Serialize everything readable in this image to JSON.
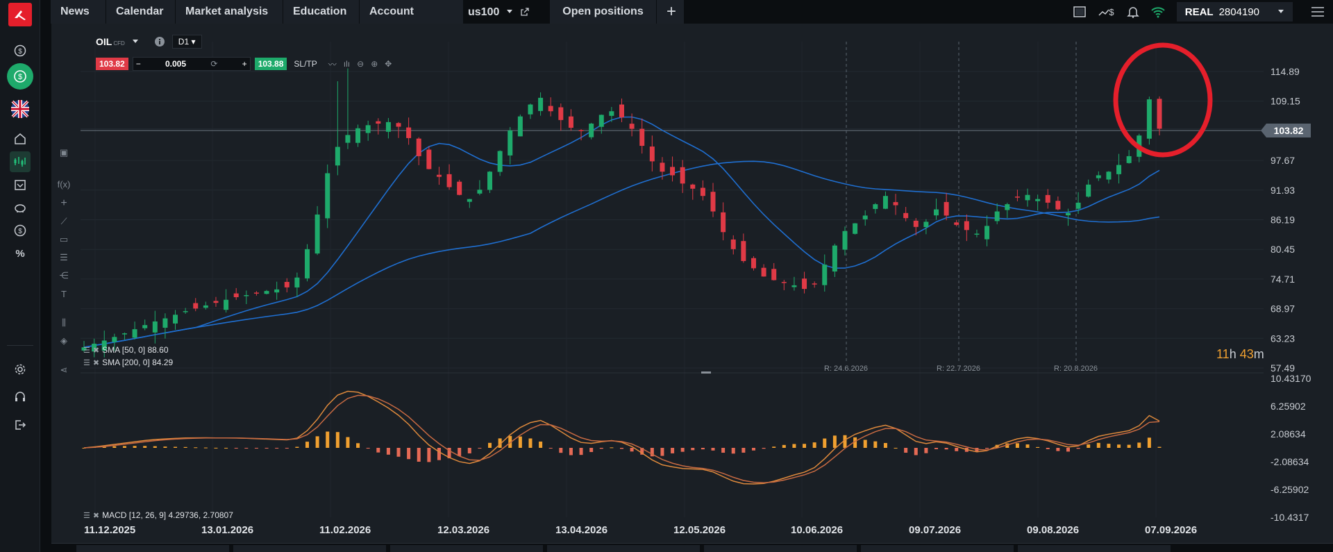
{
  "nav": {
    "tabs": [
      "News",
      "Calendar",
      "Market analysis",
      "Education",
      "Account history"
    ],
    "active_tab": "us100",
    "open_positions": "Open positions",
    "add": "+"
  },
  "account": {
    "type": "REAL",
    "number": "2804190"
  },
  "rail_icons": [
    "dollar-icon",
    "deposit-icon",
    "uk-flag-icon",
    "home-icon",
    "market-icon",
    "calendar-icon",
    "piggy-bank-icon",
    "exchange-icon",
    "percent-icon",
    "settings-icon",
    "headset-icon",
    "logout-icon"
  ],
  "instrument": {
    "symbol": "OIL",
    "type": "CFD",
    "timeframe": "D1"
  },
  "order": {
    "sell": "103.82",
    "qty": "0.005",
    "buy": "103.88",
    "sltp": "SL/TP"
  },
  "price_axis": [
    "114.89",
    "109.15",
    "103.82",
    "97.67",
    "91.93",
    "86.19",
    "80.45",
    "74.71",
    "68.97",
    "63.23",
    "57.49"
  ],
  "macd_axis": [
    "10.43170",
    "6.25902",
    "2.08634",
    "-2.08634",
    "-6.25902",
    "-10.4317"
  ],
  "current_price": "103.82",
  "date_axis": [
    "11.12.2025",
    "13.01.2026",
    "11.02.2026",
    "12.03.2026",
    "13.04.2026",
    "12.05.2026",
    "10.06.2026",
    "09.07.2026",
    "09.08.2026",
    "07.09.2026"
  ],
  "rollovers": [
    "R: 24.6.2026",
    "R: 22.7.2026",
    "R: 20.8.2026"
  ],
  "indicators": {
    "sma50": "SMA [50, 0] 88.60",
    "sma200": "SMA [200, 0] 84.29",
    "macd": "MACD [12, 26, 9] 4.29736, 2.70807"
  },
  "countdown": {
    "hours": "11",
    "h": "h",
    "minutes": "43",
    "m": "m"
  },
  "colors": {
    "up": "#1eaa6b",
    "down": "#e03a46",
    "sma": "#1f6fd1",
    "macd": "#e08a3c",
    "signal": "#c86a42",
    "accent_red": "#e51f2b"
  },
  "chart_data": {
    "type": "candlestick",
    "instrument": "OIL",
    "timeframe": "D1",
    "ylim": [
      57.49,
      114.89
    ],
    "x_ticks": [
      "11.12.2025",
      "13.01.2026",
      "11.02.2026",
      "12.03.2026",
      "13.04.2026",
      "12.05.2026",
      "10.06.2026",
      "09.07.2026",
      "09.08.2026",
      "07.09.2026"
    ],
    "close_path": [
      61.5,
      62.2,
      62.8,
      63.5,
      64.2,
      65.0,
      65.8,
      66.5,
      67.1,
      67.8,
      68.5,
      69.0,
      69.6,
      70.1,
      70.7,
      71.2,
      71.6,
      72.0,
      72.4,
      72.7,
      73.1,
      75.0,
      80.5,
      87.2,
      95.2,
      100.3,
      102.6,
      103.9,
      104.5,
      104.8,
      105.1,
      104.2,
      102.0,
      98.5,
      96.0,
      94.5,
      92.5,
      91.0,
      90.2,
      92.0,
      95.5,
      99.5,
      103.5,
      106.2,
      108.5,
      109.8,
      107.2,
      105.5,
      104.0,
      103.5,
      104.8,
      106.5,
      107.2,
      106.0,
      103.8,
      100.5,
      97.5,
      95.5,
      94.8,
      93.2,
      92.2,
      90.8,
      87.8,
      83.8,
      80.5,
      78.2,
      76.8,
      75.2,
      74.5,
      74.0,
      73.5,
      72.8,
      73.8,
      77.5,
      81.2,
      84.0,
      85.5,
      87.0,
      89.2,
      90.8,
      89.0,
      86.5,
      84.8,
      85.8,
      88.2,
      87.0,
      85.2,
      84.2,
      83.5,
      85.0,
      87.8,
      89.2,
      90.5,
      91.0,
      90.2,
      89.5,
      88.2,
      87.5,
      89.5,
      93.0,
      94.8,
      95.5,
      96.8,
      98.5,
      102.5,
      109.5,
      103.82
    ],
    "sma50_end": 88.6,
    "sma200_end": 84.29,
    "macd": {
      "macd": 4.29736,
      "signal": 2.70807
    }
  }
}
